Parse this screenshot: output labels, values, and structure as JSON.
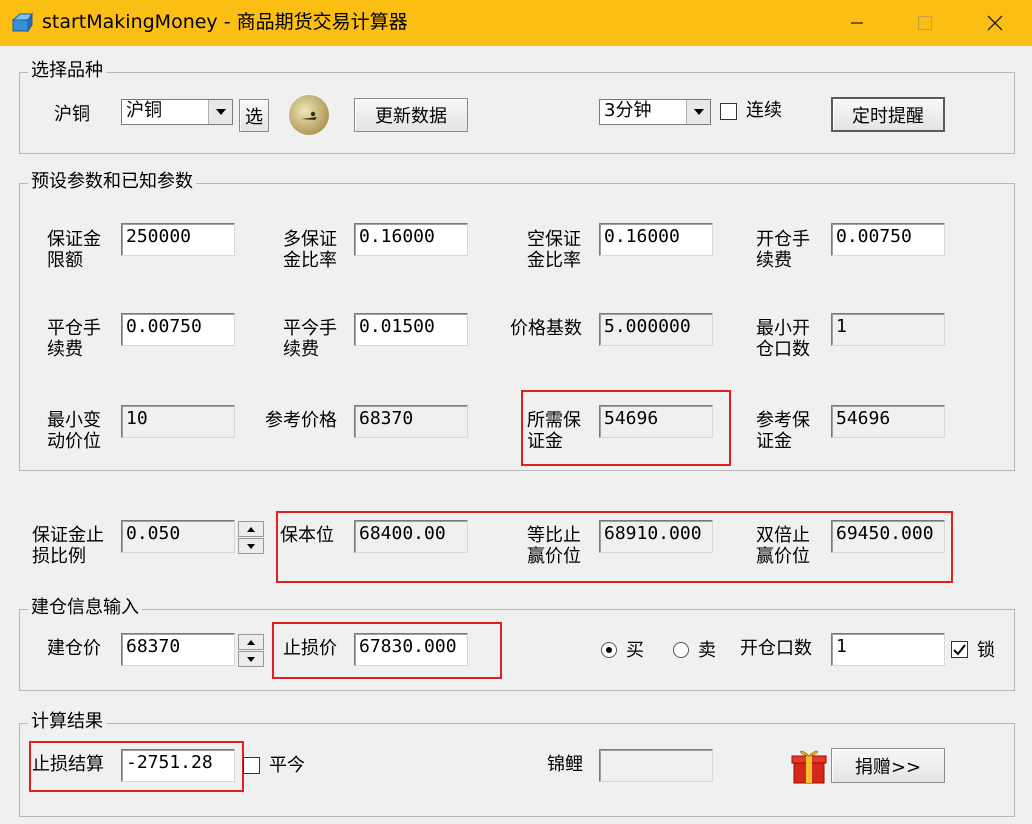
{
  "window": {
    "title": "startMakingMoney - 商品期货交易计算器",
    "minimize_icon": "minimize-icon",
    "maximize_icon": "maximize-icon",
    "close_icon": "close-icon"
  },
  "select_group": {
    "title": "选择品种",
    "product_label": "沪铜",
    "product_value": "沪铜",
    "select_button": "选",
    "update_button": "更新数据",
    "interval_value": "3分钟",
    "continuous_label": "连续",
    "continuous_checked": false,
    "timer_button": "定时提醒"
  },
  "params_group": {
    "title": "预设参数和已知参数",
    "margin_limit_label": "保证金\n限额",
    "margin_limit_value": "250000",
    "long_margin_label": "多保证\n金比率",
    "long_margin_value": "0.16000",
    "short_margin_label": "空保证\n金比率",
    "short_margin_value": "0.16000",
    "open_fee_label": "开仓手\n续费",
    "open_fee_value": "0.00750",
    "close_fee_label": "平仓手\n续费",
    "close_fee_value": "0.00750",
    "close_today_fee_label": "平今手\n续费",
    "close_today_fee_value": "0.01500",
    "price_base_label": "价格基数",
    "price_base_value": "5.000000",
    "min_lots_label": "最小开\n仓口数",
    "min_lots_value": "1",
    "min_tick_label": "最小变\n动价位",
    "min_tick_value": "10",
    "ref_price_label": "参考价格",
    "ref_price_value": "68370",
    "required_margin_label": "所需保\n证金",
    "required_margin_value": "54696",
    "ref_margin_label": "参考保\n证金",
    "ref_margin_value": "54696"
  },
  "stop_row": {
    "stop_ratio_label": "保证金止\n损比例",
    "stop_ratio_value": "0.050",
    "breakeven_label": "保本位",
    "breakeven_value": "68400.00",
    "equal_ratio_label": "等比止\n赢价位",
    "equal_ratio_value": "68910.000",
    "double_label": "双倍止\n赢价位",
    "double_value": "69450.000"
  },
  "position_group": {
    "title": "建仓信息输入",
    "entry_price_label": "建仓价",
    "entry_price_value": "68370",
    "stop_price_label": "止损价",
    "stop_price_value": "67830.000",
    "buy_label": "买",
    "sell_label": "卖",
    "buy_selected": true,
    "lots_label": "开仓口数",
    "lots_value": "1",
    "lock_label": "锁",
    "lock_checked": true
  },
  "result_group": {
    "title": "计算结果",
    "stop_settle_label": "止损结算",
    "stop_settle_value": "-2751.28",
    "close_today_label": "平今",
    "close_today_checked": false,
    "koi_label": "锦鲤",
    "koi_value": "",
    "donate_button": "捐赠>>"
  },
  "colors": {
    "titlebar": "#fbbf14",
    "highlight_box": "#e02020"
  }
}
